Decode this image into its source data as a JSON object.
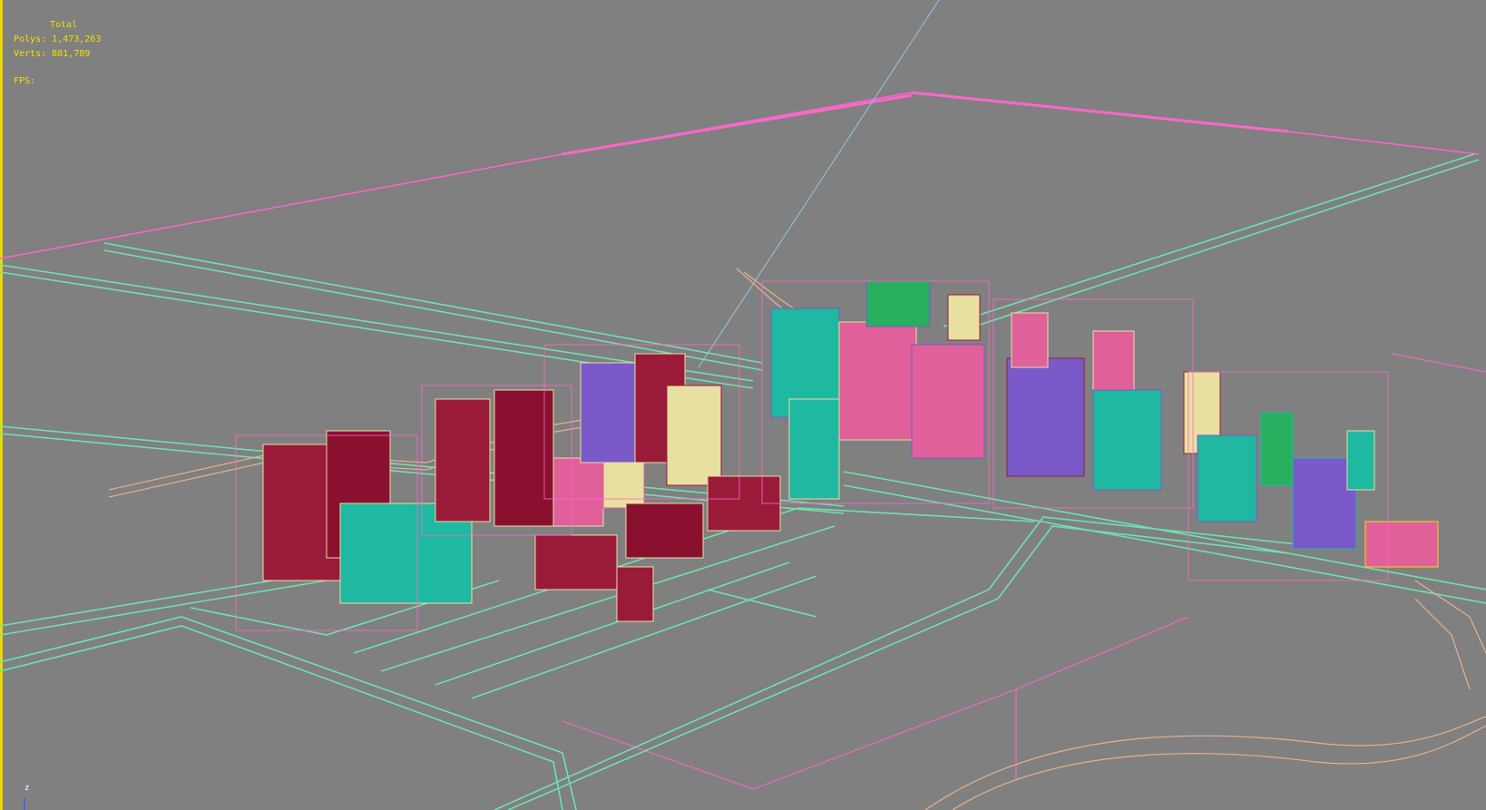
{
  "viewport": {
    "background": "#808080",
    "active_border_color": "#e8d800"
  },
  "stats": {
    "title": "Total",
    "polys_label": "Polys:",
    "polys_value": "1,473,263",
    "verts_label": "Verts:",
    "verts_value": "881,789",
    "fps_label": "FPS:"
  },
  "axis": {
    "label": "z",
    "icon": "axis-gizmo-icon"
  },
  "colors": {
    "road": "#6fe0b0",
    "boundary": "#ff66cc",
    "path": "#e8b088",
    "camera_line": "#8ec8e8",
    "building_red": "#9a1a3a",
    "building_teal": "#1fb8a0",
    "building_pink": "#e0609a",
    "building_purple": "#7a5ac8",
    "building_cream": "#e8e0a0",
    "building_green": "#28b060"
  }
}
